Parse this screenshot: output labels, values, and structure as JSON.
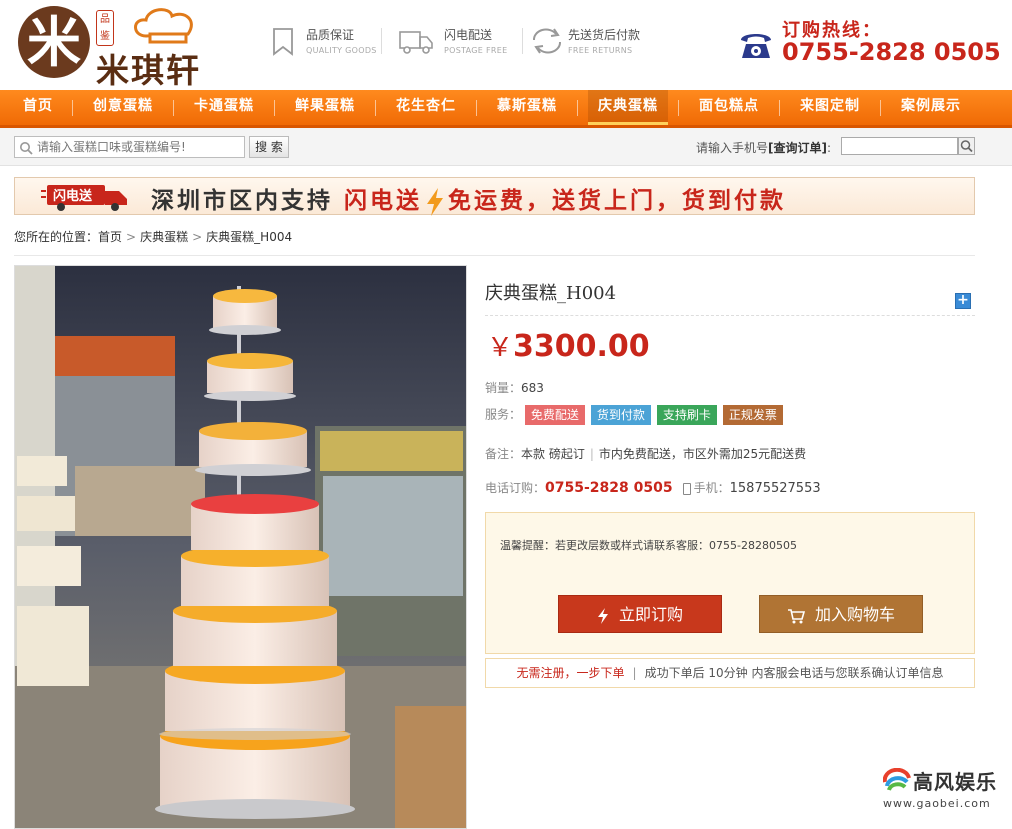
{
  "header": {
    "logo_char": "米",
    "logo_seal": "品鉴",
    "logo_name": "米琪轩",
    "features": [
      {
        "title": "品质保证",
        "subtitle": "QUALITY GOODS",
        "icon": "bookmark-icon"
      },
      {
        "title": "闪电配送",
        "subtitle": "POSTAGE FREE",
        "icon": "delivery-truck-icon"
      },
      {
        "title": "先送货后付款",
        "subtitle": "FREE RETURNS",
        "icon": "return-arrows-icon"
      }
    ],
    "hotline_label": "订购热线：",
    "hotline_number": "0755-2828 0505"
  },
  "nav": {
    "items": [
      {
        "label": "首页"
      },
      {
        "label": "创意蛋糕"
      },
      {
        "label": "卡通蛋糕"
      },
      {
        "label": "鲜果蛋糕"
      },
      {
        "label": "花生杏仁"
      },
      {
        "label": "慕斯蛋糕"
      },
      {
        "label": "庆典蛋糕"
      },
      {
        "label": "面包糕点"
      },
      {
        "label": "来图定制"
      },
      {
        "label": "案例展示"
      }
    ],
    "active_index": 6
  },
  "search": {
    "placeholder": "请输入蛋糕口味或蛋糕编号!",
    "button_label": "搜 索",
    "order_prompt": "请输入手机号",
    "order_link": "[查询订单]",
    "order_colon": ":"
  },
  "banner": {
    "badge": "闪电送",
    "text_1": "深圳市区内支持",
    "text_2": "闪电送",
    "text_3": "免运费，送货上门，货到付款"
  },
  "breadcrumb": {
    "prefix": "您所在的位置：",
    "items": [
      "首页",
      "庆典蛋糕",
      "庆典蛋糕_H004"
    ]
  },
  "product": {
    "title": "庆典蛋糕_H004",
    "currency": "￥",
    "price": "3300.00",
    "sales_label": "销量：",
    "sales_value": "683",
    "service_label": "服务：",
    "services": [
      {
        "label": "免费配送",
        "color": "#e86a6a"
      },
      {
        "label": "货到付款",
        "color": "#4ba3d6"
      },
      {
        "label": "支持刷卡",
        "color": "#3aa65a"
      },
      {
        "label": "正规发票",
        "color": "#b36a34"
      }
    ],
    "note_label": "备注：",
    "note_1": "本款 磅起订",
    "note_2": "市内免费配送，市区外需加25元配送费",
    "phone_label": "电话订购：",
    "phone_value": "0755-2828 0505",
    "mobile_label": "手机：",
    "mobile_value": "15875527553",
    "tip": "温馨提醒：若更改层数或样式请联系客服：0755-28280505",
    "buy_label": "立即订购",
    "cart_label": "加入购物车",
    "footnote_1": "无需注册，一步下单",
    "footnote_2": "成功下单后 10分钟 内客服会电话与您联系确认订单信息"
  },
  "watermark": {
    "name": "高风娱乐",
    "url": "www.gaobei.com"
  },
  "colors": {
    "nav_orange": "#f47a10",
    "price_red": "#c8261b",
    "buy_button": "#c8381c",
    "cart_button": "#b07434"
  }
}
